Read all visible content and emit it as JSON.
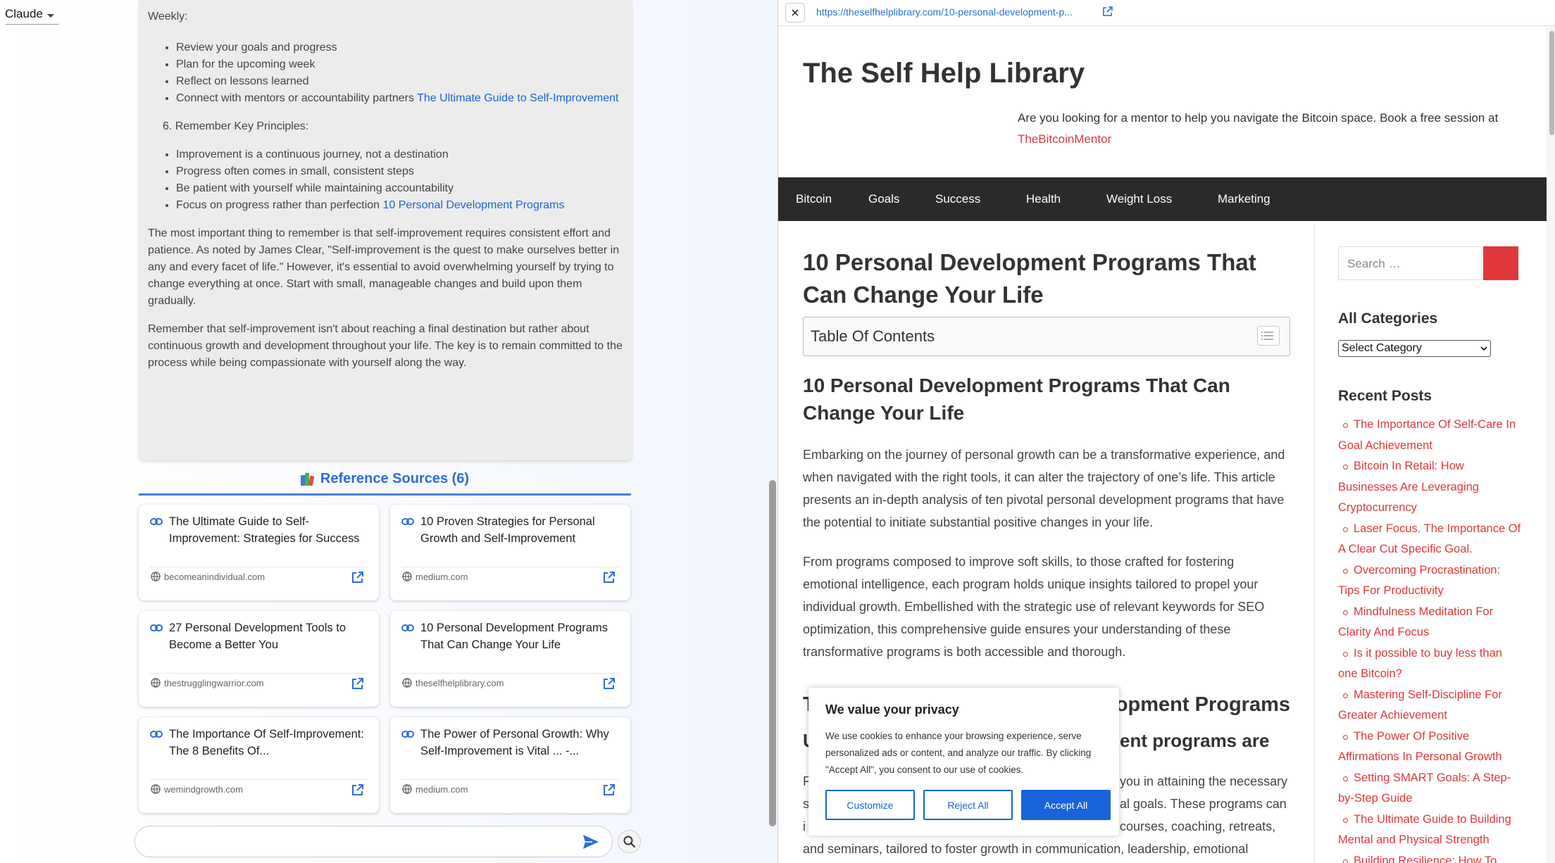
{
  "left": {
    "model_label": "Claude",
    "answer": {
      "weekly_heading": "Weekly:",
      "weekly_items": [
        "Review your goals and progress",
        "Plan for the upcoming week",
        "Reflect on lessons learned",
        "Connect with mentors or accountability partners"
      ],
      "weekly_link": "The Ultimate Guide to Self-Improvement",
      "principles_heading": "6. Remember Key Principles:",
      "principles_items": [
        "Improvement is a continuous journey, not a destination",
        "Progress often comes in small, consistent steps",
        "Be patient with yourself while maintaining accountability",
        "Focus on progress rather than perfection"
      ],
      "principles_link": "10 Personal Development Programs",
      "para1": "The most important thing to remember is that self-improvement requires consistent effort and patience. As noted by James Clear, \"Self-improvement is the quest to make ourselves better in any and every facet of life.\" However, it's essential to avoid overwhelming yourself by trying to change everything at once. Start with small, manageable changes and build upon them gradually.",
      "para2": "Remember that self-improvement isn't about reaching a final destination but rather about continuous growth and development throughout your life. The key is to remain committed to the process while being compassionate with yourself along the way."
    },
    "references_title": "Reference Sources (6)",
    "references": [
      {
        "title": "The Ultimate Guide to Self-Improvement: Strategies for Success",
        "domain": "becomeanindividual.com"
      },
      {
        "title": "10 Proven Strategies for Personal Growth and Self-Improvement",
        "domain": "medium.com"
      },
      {
        "title": "27 Personal Development Tools to Become a Better You",
        "domain": "thestrugglingwarrior.com"
      },
      {
        "title": "10 Personal Development Programs That Can Change Your Life",
        "domain": "theselfhelplibrary.com"
      },
      {
        "title": "The Importance Of Self-Improvement: The 8 Benefits Of...",
        "domain": "wemindgrowth.com"
      },
      {
        "title": "The Power of Personal Growth: Why Self-Improvement is Vital ... -...",
        "domain": "medium.com"
      }
    ],
    "input_placeholder": ""
  },
  "right": {
    "url": "https://theselfhelplibrary.com/10-personal-development-p...",
    "site_title": "The Self Help Library",
    "promo_text": "Are you looking for a mentor to help you navigate the Bitcoin space. Book a free session at",
    "promo_link": "TheBitcoinMentor",
    "nav": [
      "Bitcoin",
      "Goals",
      "Success",
      "Health",
      "Weight Loss",
      "Marketing"
    ],
    "article": {
      "title": "10 Personal Development Programs That Can Change Your Life",
      "toc_title": "Table Of Contents",
      "subtitle": "10 Personal Development Programs That Can Change Your Life",
      "p1": "Embarking on the journey of personal growth can be a transformative experience, and when navigated with the right tools, it can alter the trajectory of one’s life. This article presents an in-depth analysis of ten pivotal personal development programs that have the potential to initiate substantial positive changes in your life.",
      "p2": "From programs composed to improve soft skills, to those crafted for fostering emotional intelligence, each program holds unique insights tailored to propel your individual growth. Embellished with the strategic use of relevant keywords for SEO optimization, this comprehensive guide ensures your understanding of these transformative programs is both accessible and thorough.",
      "h2b_visible": "lopment Programs",
      "h2c_visible": "ent programs are",
      "p3_line1": "you in attaining the necessary",
      "p3_line2": "al goals. These programs can",
      "p3_line3": "courses, coaching, retreats,",
      "p3_line4": "and seminars, tailored to foster growth in communication, leadership, emotional",
      "p3_lead1": "F",
      "p3_lead2": "s",
      "p3_lead3": "i",
      "h2b_lead": "T",
      "h2c_lead": "U"
    },
    "sidebar": {
      "search_placeholder": "Search …",
      "categories_heading": "All Categories",
      "category_select": "Select Category",
      "recent_heading": "Recent Posts",
      "recent_posts": [
        "The Importance Of Self-Care In Goal Achievement",
        "Bitcoin In Retail: How Businesses Are Leveraging Cryptocurrency",
        "Laser Focus. The Importance Of A Clear Cut Specific Goal.",
        "Overcoming Procrastination: Tips For Productivity",
        "Mindfulness Meditation For Clarity And Focus",
        "Is it possible to buy less than one Bitcoin?",
        "Mastering Self-Discipline For Greater Achievement",
        "The Power Of Positive Affirmations In Personal Growth",
        "Setting SMART Goals: A Step-by-Step Guide",
        "The Ultimate Guide to Building Mental and Physical Strength",
        "Building Resilience: How To"
      ]
    },
    "cookie": {
      "title": "We value your privacy",
      "text": "We use cookies to enhance your browsing experience, serve personalized ads or content, and analyze our traffic. By clicking \"Accept All\", you consent to our use of cookies.",
      "customize": "Customize",
      "reject": "Reject All",
      "accept": "Accept All"
    },
    "colors": {
      "accent": "#e0383a",
      "link_blue": "#1d63d8",
      "cookie_blue": "#1863dc",
      "nav_bg": "#2a2a2a"
    }
  }
}
